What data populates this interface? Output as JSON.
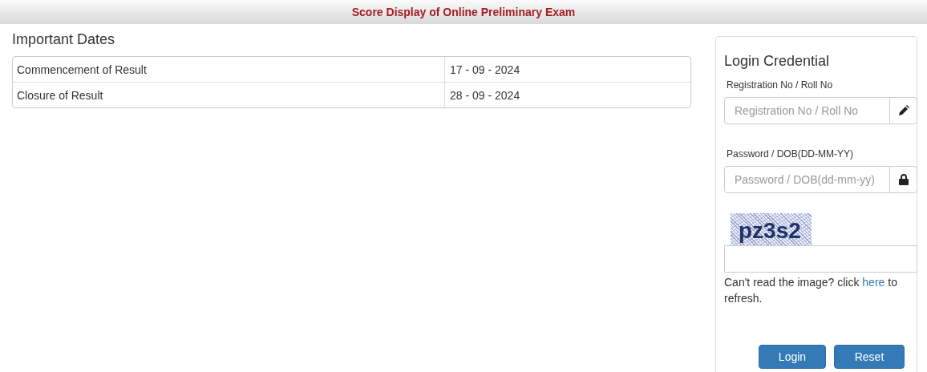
{
  "header": {
    "title": "Score Display of Online Preliminary Exam"
  },
  "important_dates": {
    "title": "Important Dates",
    "rows": [
      {
        "event": "Commencement of Result",
        "date": "17 - 09 - 2024"
      },
      {
        "event": "Closure of Result",
        "date": "28 - 09 - 2024"
      }
    ]
  },
  "login": {
    "title": "Login Credential",
    "fields": [
      {
        "label": "Registration No / Roll No",
        "placeholder": "Registration No / Roll No",
        "kind": "pencil"
      },
      {
        "label": "Password / DOB(DD-MM-YY)",
        "placeholder": "Password / DOB(dd-mm-yy)",
        "kind": "lock"
      }
    ],
    "captcha": {
      "text": "pz3s2"
    },
    "help": {
      "before": "Can't read the image? click ",
      "link": "here",
      "after": " to refresh."
    },
    "buttons": [
      "Login",
      "Reset"
    ]
  }
}
